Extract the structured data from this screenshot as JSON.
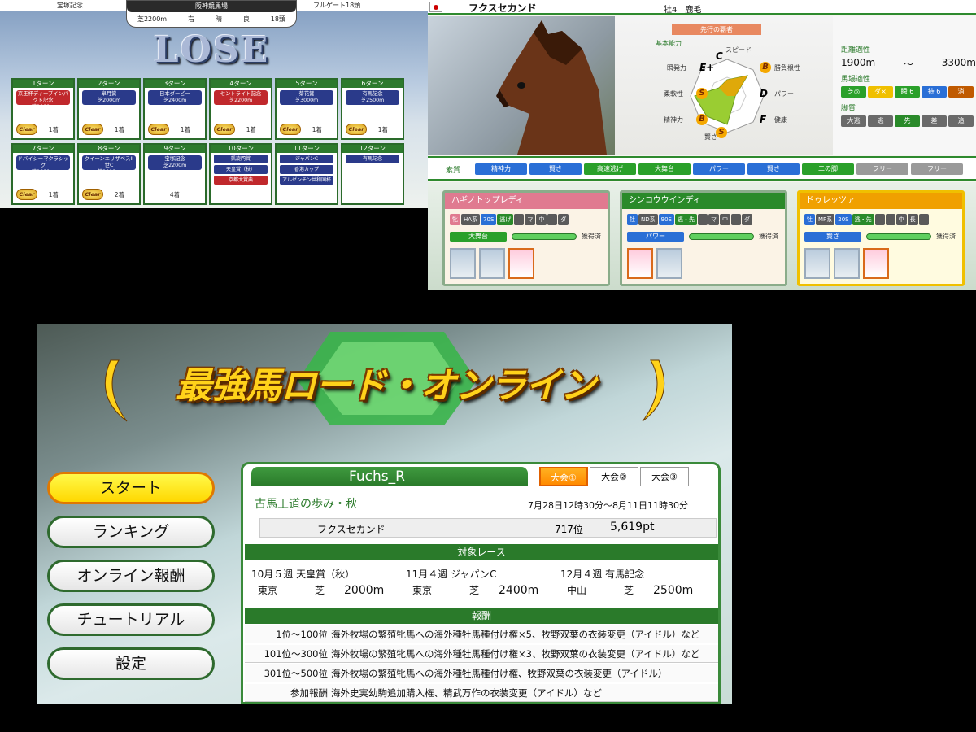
{
  "race": {
    "left_label": "宝塚記念",
    "right_label": "フルゲート18頭",
    "course": "阪神競馬場",
    "surface": "芝2200m",
    "direction": "右",
    "weather": "晴",
    "condition": "良",
    "field": "18頭",
    "result": "LOSE",
    "clear_label": "Clear",
    "turns": [
      {
        "turn": "1ターン",
        "races": [
          "京王杯ディープインパクト記念",
          "芝2000m"
        ],
        "color": "red",
        "place": "1着",
        "clear": true
      },
      {
        "turn": "2ターン",
        "races": [
          "皐月賞",
          "芝2000m"
        ],
        "color": "blue",
        "place": "1着",
        "clear": true
      },
      {
        "turn": "3ターン",
        "races": [
          "日本ダービー",
          "芝2400m"
        ],
        "color": "blue",
        "place": "1着",
        "clear": true
      },
      {
        "turn": "4ターン",
        "races": [
          "セントライト記念",
          "芝2200m"
        ],
        "color": "red",
        "place": "1着",
        "clear": true
      },
      {
        "turn": "5ターン",
        "races": [
          "菊花賞",
          "芝3000m"
        ],
        "color": "blue",
        "place": "1着",
        "clear": true
      },
      {
        "turn": "6ターン",
        "races": [
          "有馬記念",
          "芝2500m"
        ],
        "color": "blue",
        "place": "1着",
        "clear": true
      },
      {
        "turn": "7ターン",
        "races": [
          "ドバイシーマクラシック",
          "芝2400m"
        ],
        "color": "blue",
        "place": "1着",
        "clear": true
      },
      {
        "turn": "8ターン",
        "races": [
          "クイーンエリザベスII世C",
          "芝2000m"
        ],
        "color": "blue",
        "place": "2着",
        "clear": true
      },
      {
        "turn": "9ターン",
        "races": [
          "宝塚記念",
          "芝2200m"
        ],
        "color": "blue",
        "place": "4着",
        "clear": false
      },
      {
        "turn": "10ターン",
        "mini": [
          "凱旋門賞",
          "天皇賞（秋）",
          "京都大賞典"
        ]
      },
      {
        "turn": "11ターン",
        "mini": [
          "ジャパンC",
          "香港カップ",
          "アルゼンチン共和国杯"
        ]
      },
      {
        "turn": "12ターン",
        "mini": [
          "有馬記念"
        ]
      }
    ]
  },
  "horse": {
    "name": "フクスセカンド",
    "age": "牡4",
    "coat": "鹿毛",
    "style_band": "先行の覇者",
    "basic": "基本能力",
    "stats": [
      {
        "l": "スピード",
        "g": "C"
      },
      {
        "l": "勝負根性",
        "g": "B"
      },
      {
        "l": "パワー",
        "g": "D"
      },
      {
        "l": "健康",
        "g": "F"
      },
      {
        "l": "賢さ",
        "g": "S"
      },
      {
        "l": "精神力",
        "g": "B"
      },
      {
        "l": "柔軟性",
        "g": "S"
      },
      {
        "l": "瞬発力",
        "g": "E+"
      }
    ],
    "dist_label": "距離適性",
    "dist_min": "1900m",
    "dist_sep": "～",
    "dist_max": "3300m",
    "track_label": "馬場適性",
    "track": [
      "芝◎",
      "ダ×",
      "瞬 6",
      "持 6",
      "消"
    ],
    "legs_label": "脚質",
    "legs": [
      "大逃",
      "逃",
      "先",
      "差",
      "追"
    ],
    "sosi_label": "素質",
    "sosi": [
      {
        "t": "精神力",
        "c": "#2a6fd6"
      },
      {
        "t": "賢さ",
        "c": "#2a6fd6"
      },
      {
        "t": "高速逃げ",
        "c": "#2aa02a"
      },
      {
        "t": "大舞台",
        "c": "#2aa02a"
      },
      {
        "t": "パワー",
        "c": "#2a6fd6"
      },
      {
        "t": "賢さ",
        "c": "#2a6fd6"
      },
      {
        "t": "二の脚",
        "c": "#2aa02a"
      },
      {
        "t": "フリー",
        "c": "#9a9a9a"
      },
      {
        "t": "フリー",
        "c": "#9a9a9a"
      }
    ],
    "cards": [
      {
        "name": "ハギノトップレディ",
        "hc": "#e07a90",
        "row": [
          "牝",
          "HA系",
          "70S",
          "逃げ",
          "",
          "マ",
          "中",
          "",
          "ダ"
        ],
        "skill": "大舞台",
        "sc": "#2aa02a",
        "got": "獲得済",
        "n": 3
      },
      {
        "name": "シンコウウインディ",
        "hc": "#2a8a2a",
        "row": [
          "牡",
          "ND系",
          "90S",
          "逃・先",
          "",
          "マ",
          "中",
          "",
          "ダ"
        ],
        "skill": "パワー",
        "sc": "#2a6fd6",
        "got": "獲得済",
        "n": 2
      },
      {
        "name": "ドゥレッツァ",
        "hc": "#f0a000",
        "row": [
          "牡",
          "MP系",
          "20S",
          "逃・先",
          "",
          "",
          "中",
          "長",
          ""
        ],
        "skill": "賢さ",
        "sc": "#2a6fd6",
        "got": "獲得済",
        "n": 3
      }
    ]
  },
  "online": {
    "title": "最強馬ロード・オンライン",
    "menu": [
      "スタート",
      "ランキング",
      "オンライン報酬",
      "チュートリアル",
      "設定"
    ],
    "user": "Fuchs_R",
    "tabs": [
      "大会①",
      "大会②",
      "大会③"
    ],
    "event": "古馬王道の歩み・秋",
    "period": "7月28日12時30分～8月11日11時30分",
    "rank_horse": "フクスセカンド",
    "rank": "717位",
    "points": "5,619pt",
    "target_label": "対象レース",
    "targets": [
      {
        "date": "10月５週 天皇賞（秋）",
        "place": "東京",
        "surf": "芝",
        "dist": "2000m"
      },
      {
        "date": "11月４週 ジャパンC",
        "place": "東京",
        "surf": "芝",
        "dist": "2400m"
      },
      {
        "date": "12月４週 有馬記念",
        "place": "中山",
        "surf": "芝",
        "dist": "2500m"
      }
    ],
    "reward_label": "報酬",
    "rewards": [
      {
        "r": "1位～100位",
        "t": "海外牧場の繁殖牝馬への海外種牡馬種付け権×5、牧野双葉の衣装変更（アイドル）など"
      },
      {
        "r": "101位～300位",
        "t": "海外牧場の繁殖牝馬への海外種牡馬種付け権×3、牧野双葉の衣装変更（アイドル）など"
      },
      {
        "r": "301位～500位",
        "t": "海外牧場の繁殖牝馬への海外種牡馬種付け権、牧野双葉の衣装変更（アイドル）"
      },
      {
        "r": "参加報酬",
        "t": "海外史実幼駒追加購入権、精武万作の衣装変更（アイドル）など"
      }
    ]
  }
}
